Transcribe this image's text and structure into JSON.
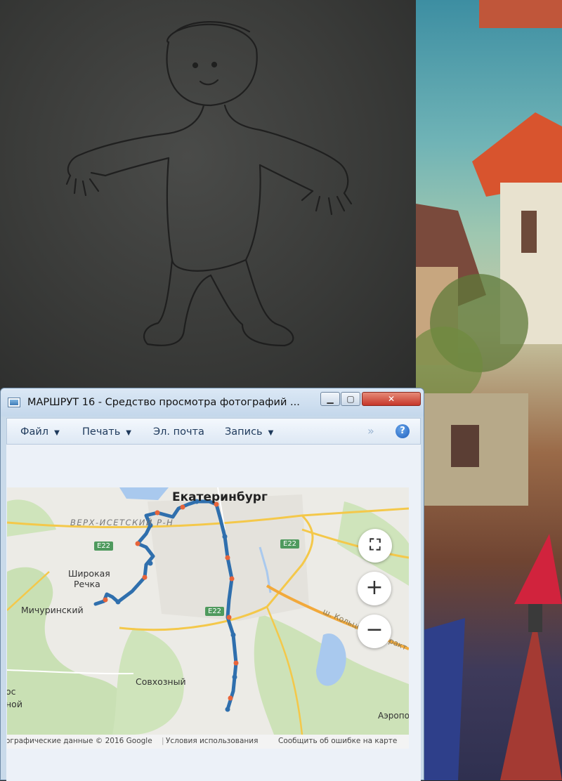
{
  "window": {
    "title": "МАРШРУТ 16 - Средство просмотра фотографий ...",
    "min_glyph": "▁",
    "max_glyph": "▢",
    "close_glyph": "✕"
  },
  "toolbar": {
    "file_label": "Файл",
    "print_label": "Печать",
    "mail_label": "Эл. почта",
    "record_label": "Запись",
    "arrow_glyph": "▼",
    "overflow_glyph": "»",
    "help_glyph": "?"
  },
  "map": {
    "labels": {
      "city": "Екатеринбург",
      "district": "ВЕРХ-ИСЕТСКИЙ Р-Н",
      "shirokaya_line1": "Широкая",
      "shirokaya_line2": "Речка",
      "michurinsky": "Мичуринский",
      "sovkhozny": "Совхозный",
      "ros": "ос",
      "noy": "ной",
      "aero": "Аэропо",
      "koltsovsky": "ш. Кольцовский тракт"
    },
    "road_shields": [
      "E22",
      "E22",
      "E22"
    ],
    "controls": {
      "fullscreen_glyph": "⛶",
      "zoom_in_glyph": "+",
      "zoom_out_glyph": "−"
    },
    "attribution": {
      "data": "ографические данные © 2016 Google",
      "terms": "Условия использования",
      "report": "Сообщить об ошибке на карте"
    },
    "colors": {
      "route": "#2f6fad",
      "route_marker": "#e8643a"
    }
  }
}
